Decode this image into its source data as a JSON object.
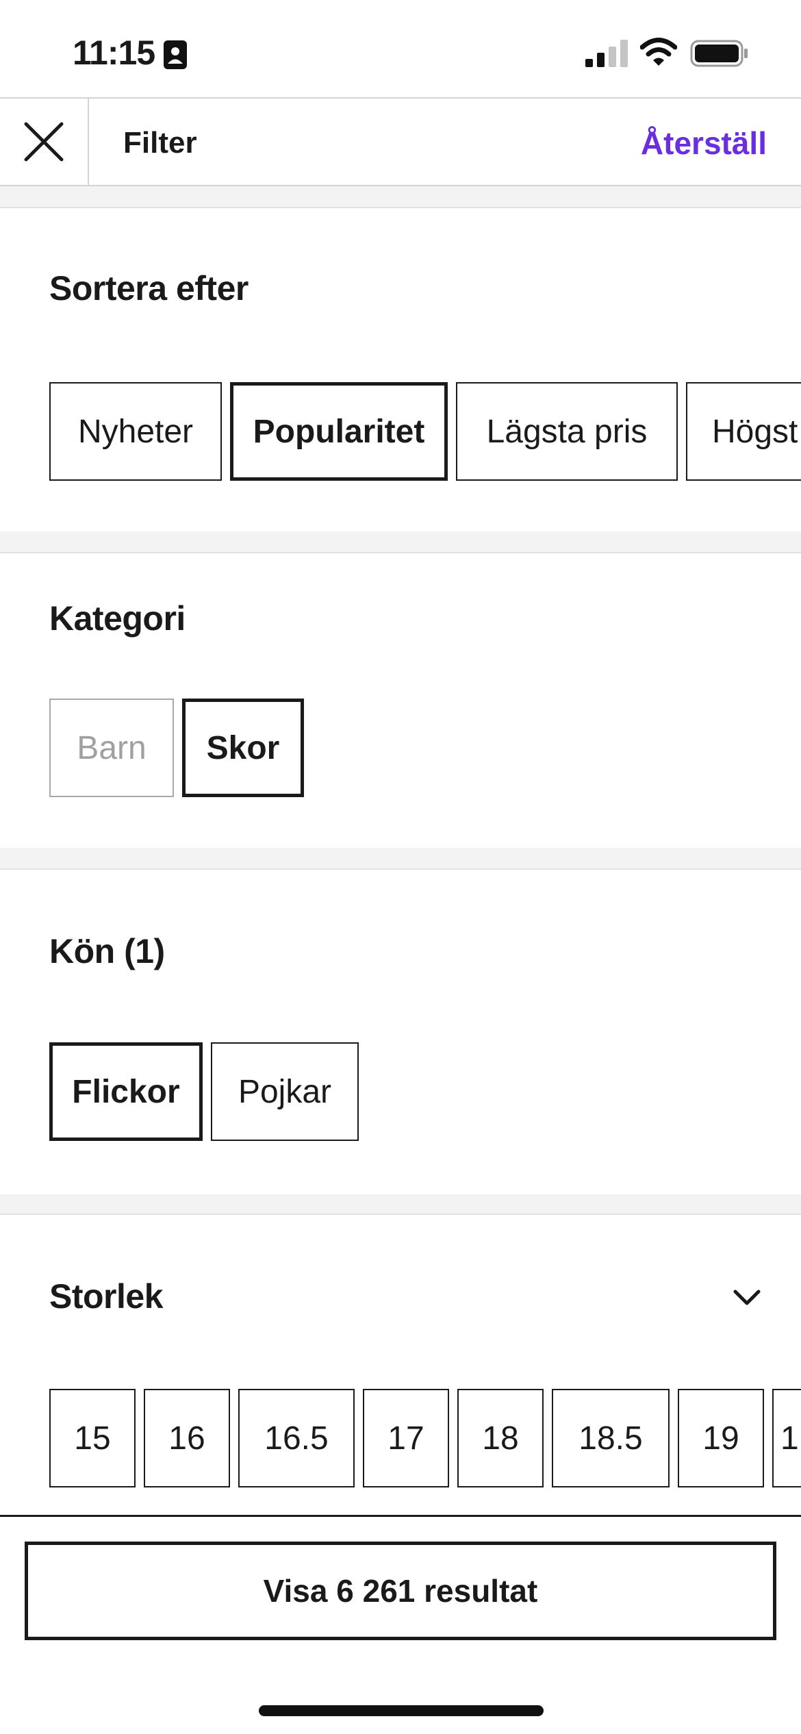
{
  "status_bar": {
    "time": "11:15",
    "icons": [
      "contact-card-icon",
      "cellular-signal-icon",
      "wifi-icon",
      "battery-icon"
    ]
  },
  "header": {
    "title": "Filter",
    "reset_label": "Återställ",
    "close_icon": "close-icon",
    "accent_color": "#6a2ee0"
  },
  "sort": {
    "title": "Sortera efter",
    "options": [
      "Nyheter",
      "Popularitet",
      "Lägsta pris",
      "Högst"
    ],
    "selected": "Popularitet"
  },
  "category": {
    "title": "Kategori",
    "options": [
      "Barn",
      "Skor"
    ],
    "selected": "Skor",
    "disabled": [
      "Barn"
    ]
  },
  "gender": {
    "title": "Kön (1)",
    "options": [
      "Flickor",
      "Pojkar"
    ],
    "selected": "Flickor"
  },
  "size": {
    "title": "Storlek",
    "expand_icon": "chevron-down-icon",
    "options": [
      "15",
      "16",
      "16.5",
      "17",
      "18",
      "18.5",
      "19",
      "1"
    ]
  },
  "footer": {
    "show_results_label": "Visa 6 261 resultat"
  }
}
